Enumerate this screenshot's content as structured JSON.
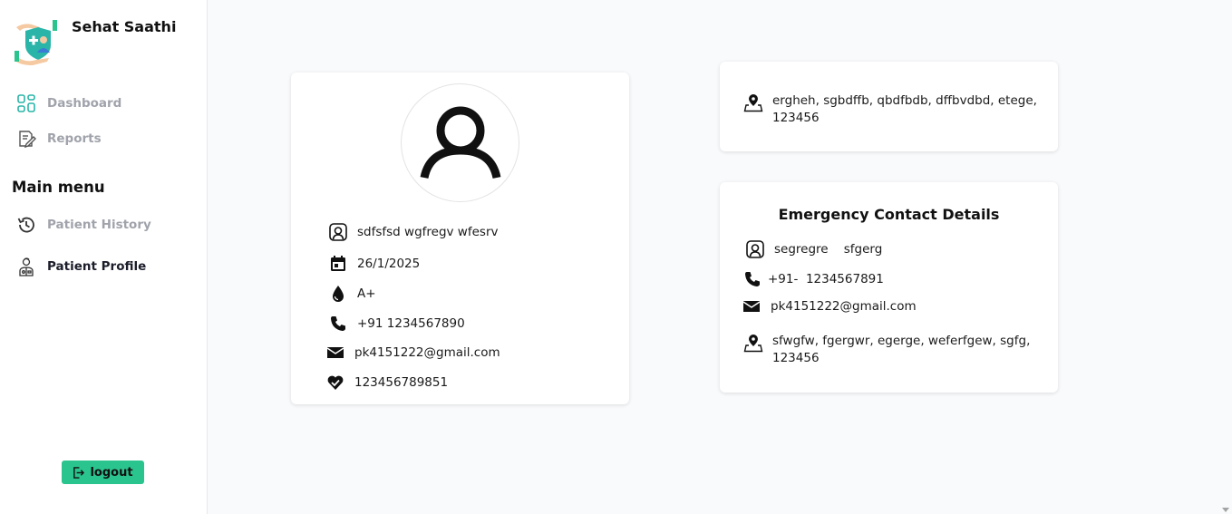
{
  "app": {
    "name": "Sehat Saathi"
  },
  "sidebar": {
    "items": [
      {
        "label": "Dashboard",
        "icon": "dashboard-grid-icon"
      },
      {
        "label": "Reports",
        "icon": "report-edit-icon"
      }
    ],
    "menu_heading": "Main menu",
    "menu_items": [
      {
        "label": "Patient History",
        "icon": "history-icon"
      },
      {
        "label": "Patient Profile",
        "icon": "doctor-profile-icon"
      }
    ],
    "logout_label": "logout"
  },
  "profile": {
    "name": "sdfsfsd  wgfregv  wfesrv",
    "dob": "26/1/2025",
    "blood_group": "A+",
    "phone": "+91  1234567890",
    "email": "pk4151222@gmail.com",
    "health_id": "123456789851"
  },
  "address": {
    "text": "ergheh, sgbdffb, qbdfbdb, dffbvdbd, etege, 123456"
  },
  "emergency": {
    "title": "Emergency Contact Details",
    "name": "segregre    sfgerg",
    "phone": "+91-  1234567891",
    "email": "pk4151222@gmail.com",
    "address": "sfwgfw, fgergwr, egerge, weferfgew, sgfg, 123456"
  },
  "colors": {
    "accent": "#2ac48e",
    "active_text": "#1b1d2a",
    "inactive_text": "#a0a3ab",
    "background": "#f9fafc"
  }
}
